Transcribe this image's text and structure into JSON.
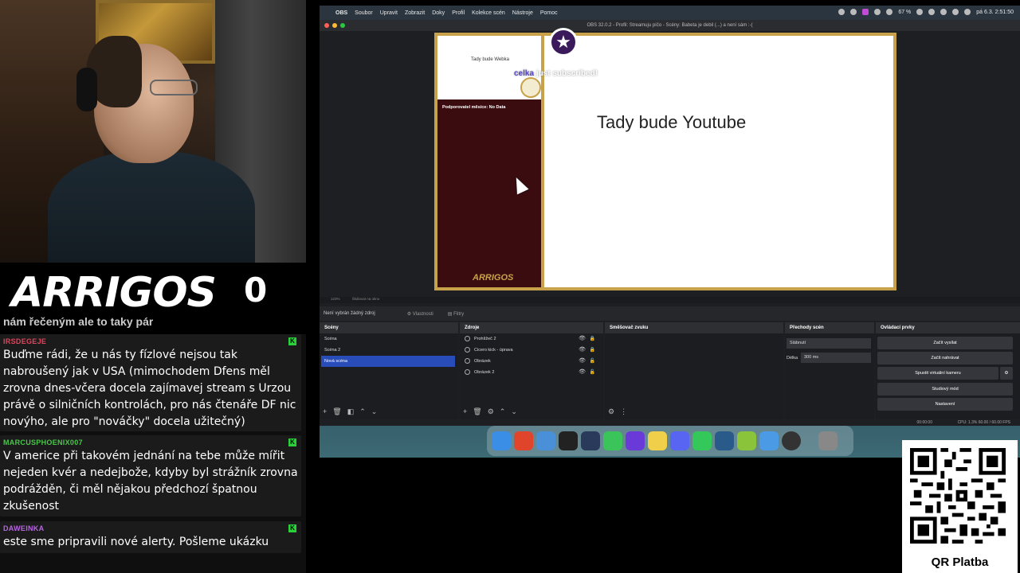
{
  "stream": {
    "brand": "ARRIGOS",
    "counter": "0",
    "chat_clipped_line": "nám řečeným ale to taky pár"
  },
  "chat": [
    {
      "user": "IRSDEGEJE",
      "user_color": "#e0455c",
      "text": "Buďme rádi, že u nás ty fízlové nejsou tak nabroušený jak v USA (mimochodem Dfens měl zrovna dnes-včera docela zajímavej stream s Urzou právě o silničních kontrolách, pro nás čtenáře DF nic novýho, ale pro \"nováčky\" docela užitečný)"
    },
    {
      "user": "MARCUSPHOENIX007",
      "user_color": "#4ac74a",
      "text": "V americe při takovém jednání na tebe může mířit nejeden kvér a nedejbože, kdyby byl strážník zrovna podrážděn, či měl nějakou předchozí špatnou zkušenost"
    },
    {
      "user": "DAWEINKA",
      "user_color": "#b766e0",
      "text": "este sme pripravili nové alerty. Pošleme ukázku"
    }
  ],
  "menubar": {
    "app": "OBS",
    "items": [
      "Soubor",
      "Upravit",
      "Zobrazit",
      "Doky",
      "Profil",
      "Kolekce scén",
      "Nástroje",
      "Pomoc"
    ],
    "battery": "67 %",
    "clock": "pá 6.3. 2:51:50"
  },
  "obs": {
    "window_title": "OBS 32.0.2 - Profil: Streamuju píčo - Scény: Babeta je debil (...) a není sám :-(",
    "canvas": {
      "webcam_label": "Tady bude Webka",
      "supporter_label": "Podporovatel měsíce: No Data",
      "youtube_label": "Tady bude Youtube",
      "sub_name": "celka",
      "sub_text": "just subscribed!",
      "mini_logo": "ARRIGOS"
    },
    "zoom": "123%",
    "zoom_mode": "Škálovat na okno",
    "no_source": "Není vybrán žádný zdroj",
    "properties_btn": "Vlastnosti",
    "filters_btn": "Filtry",
    "docks": {
      "scenes": {
        "title": "Scény",
        "items": [
          "Scéna",
          "Scéna 2",
          "Nová scéna"
        ],
        "active_index": 2
      },
      "sources": {
        "title": "Zdroje",
        "items": [
          "Prohlížeč 2",
          "Cicero kick - úprava",
          "Obrázek",
          "Obrázek 2"
        ]
      },
      "mixer": {
        "title": "Směšovač zvuku"
      },
      "transitions": {
        "title": "Přechody scén",
        "selected": "Slábnutí",
        "duration_label": "Délka",
        "duration": "300 ms"
      },
      "controls": {
        "title": "Ovládací prvky",
        "buttons": [
          "Začít vysílat",
          "Začít nahrávat",
          "Spustit virtuální kameru",
          "Studiový mód",
          "Nastavení"
        ]
      }
    },
    "status": {
      "timecode1": "00:00:00",
      "timecode2": "00:00:00",
      "cpu": "CPU: 1.3%",
      "fps": "60.00 / 60.00 FPS"
    }
  },
  "qr": {
    "label": "QR Platba"
  }
}
